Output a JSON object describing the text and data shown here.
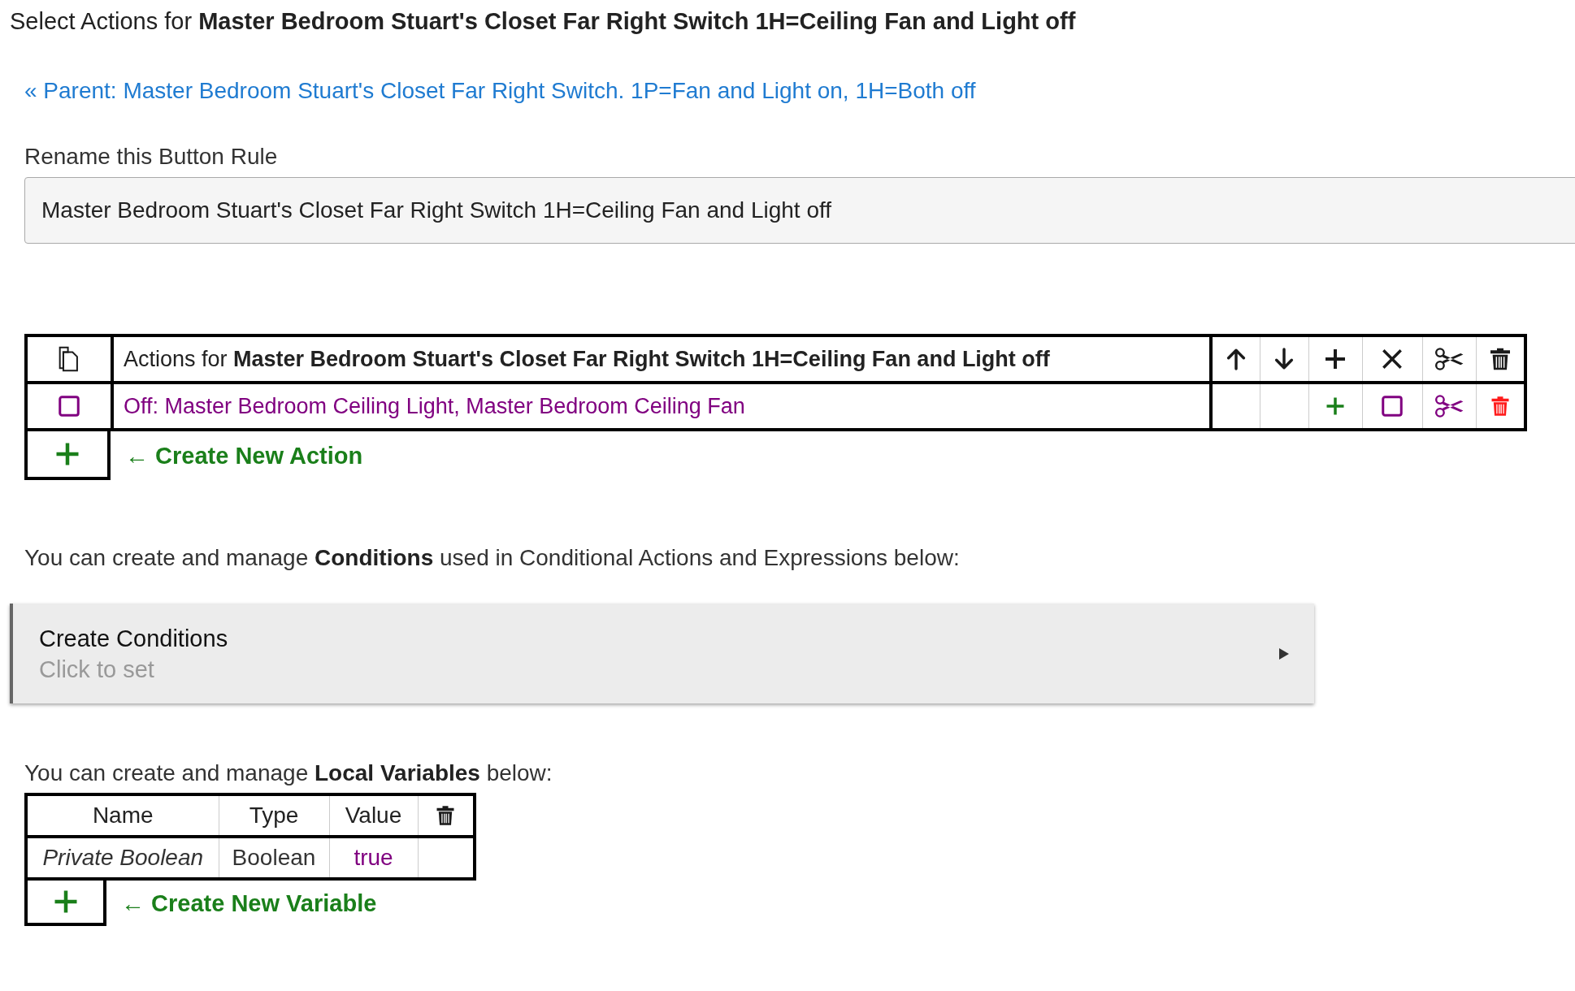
{
  "title": "Select Actions for **Master Bedroom Stuart's Closet Far Right Switch 1H=Ceiling Fan and Light off**",
  "parent_link": "« Parent: Master Bedroom Stuart's Closet Far Right Switch. 1P=Fan and Light on, 1H=Both off",
  "rename": {
    "label": "Rename this Button Rule",
    "value": "Master Bedroom Stuart's Closet Far Right Switch 1H=Ceiling Fan and Light off"
  },
  "actions_table": {
    "header": "Actions for **Master Bedroom Stuart's Closet Far Right Switch 1H=Ceiling Fan and Light off**",
    "header_tools": [
      {
        "kind": "up"
      },
      {
        "kind": "down"
      },
      {
        "kind": "insert"
      },
      {
        "kind": "disable"
      },
      {
        "kind": "cut"
      },
      {
        "kind": "delete"
      }
    ],
    "rows": [
      {
        "text": "Off: Master Bedroom Ceiling Light, Master Bedroom Ceiling Fan",
        "selected": false,
        "tools": [
          {
            "kind": "none"
          },
          {
            "kind": "none"
          },
          {
            "kind": "insert"
          },
          {
            "kind": "disable",
            "checked": false
          },
          {
            "kind": "cut"
          },
          {
            "kind": "delete"
          }
        ]
      }
    ],
    "create_link": "← Create New Action"
  },
  "conditions_intro": "You can create and manage **Conditions** used in Conditional Actions and Expressions below:",
  "conditions": {
    "title": "Create Conditions",
    "hint": "Click to set"
  },
  "variables_intro": "You can create and manage **Local Variables** below:",
  "variables_table": {
    "columns": [
      "Name",
      "Type",
      "Value"
    ],
    "rows": [
      {
        "name": "Private Boolean",
        "type": "Boolean",
        "value": "true"
      }
    ],
    "create_link": "← Create New Variable"
  }
}
